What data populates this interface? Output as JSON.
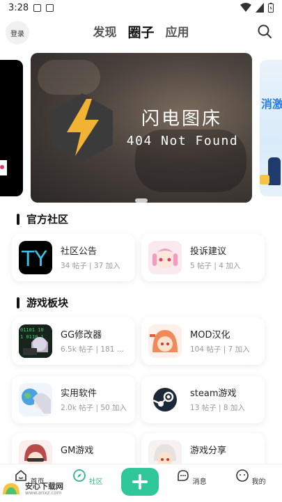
{
  "status_bar": {
    "time": "3:28"
  },
  "top_nav": {
    "login_label": "登录",
    "tabs": [
      {
        "label": "发现",
        "active": false
      },
      {
        "label": "圈子",
        "active": true
      },
      {
        "label": "应用",
        "active": false
      }
    ]
  },
  "banner": {
    "title": "闪电图床",
    "subtitle": "404 Not Found",
    "right_peek_text": "消激"
  },
  "sections": [
    {
      "title": "官方社区",
      "cards": [
        {
          "name": "社区公告",
          "meta": "34 帖子 | 37 加入",
          "avatar": "ty-logo"
        },
        {
          "name": "投诉建议",
          "meta": "5 帖子 | 4 加入",
          "avatar": "anime-girl-pink"
        }
      ]
    },
    {
      "title": "游戏板块",
      "cards": [
        {
          "name": "GG修改器",
          "meta": "6.5k 帖子 | 181 ...",
          "avatar": "anime-coder"
        },
        {
          "name": "MOD汉化",
          "meta": "104 帖子 | 7 加入",
          "avatar": "anime-girl-orange"
        },
        {
          "name": "实用软件",
          "meta": "2.0k 帖子 | 50 加入",
          "avatar": "anime-globe"
        },
        {
          "name": "steam游戏",
          "meta": "13 帖子 | 8 加入",
          "avatar": "steam-logo"
        },
        {
          "name": "GM游戏",
          "meta": "",
          "avatar": "anime-girl-red"
        },
        {
          "name": "游戏分享",
          "meta": "",
          "avatar": "anime-girl-white"
        }
      ]
    }
  ],
  "bottom_nav": {
    "items": [
      {
        "label": "首页",
        "icon": "home-icon"
      },
      {
        "label": "社区",
        "icon": "compass-icon",
        "active": true
      },
      {
        "label": "消息",
        "icon": "message-icon"
      },
      {
        "label": "我的",
        "icon": "profile-icon"
      }
    ]
  },
  "watermark": {
    "title": "安心下载网",
    "url": "www.anxz.com"
  },
  "colors": {
    "accent": "#2fc69a",
    "active_tab_text": "#2ab58a"
  }
}
